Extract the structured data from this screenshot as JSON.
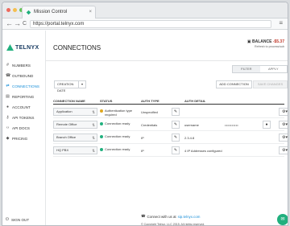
{
  "browser": {
    "tab_title": "Mission Control",
    "url": "https://portal.telnyx.com",
    "back_glyph": "←",
    "forward_glyph": "→",
    "reload_glyph": "C",
    "menu_glyph": "≡"
  },
  "brand": {
    "name": "TELNYX",
    "accent": "#1a8fd8"
  },
  "sidebar": {
    "items": [
      {
        "label": "NUMBERS",
        "icon": "hash-icon",
        "glyph": "#"
      },
      {
        "label": "OUTBOUND",
        "icon": "phone-icon",
        "glyph": "☎"
      },
      {
        "label": "CONNECTIONS",
        "icon": "connections-icon",
        "glyph": "⇄"
      },
      {
        "label": "REPORTING",
        "icon": "chart-icon",
        "glyph": "▤"
      },
      {
        "label": "ACCOUNT",
        "icon": "user-icon",
        "glyph": "●"
      },
      {
        "label": "API TOKENS",
        "icon": "key-icon",
        "glyph": "⚷"
      },
      {
        "label": "API DOCS",
        "icon": "code-icon",
        "glyph": "‹›"
      },
      {
        "label": "PRICING",
        "icon": "tag-icon",
        "glyph": "◆"
      }
    ],
    "sign_out": "SIGN OUT"
  },
  "header": {
    "title": "CONNECTIONS",
    "balance_label": "BALANCE",
    "balance_amount": "-$5.37",
    "balance_sub": "Refresh to process/sub"
  },
  "toolbar": {
    "filter_label": "FILTER",
    "apply_label": "APPLY",
    "sort_label": "CREATION DATE",
    "sort_glyph": "▾",
    "add_label": "ADD CONNECTION",
    "save_label": "SAVE CHANGES"
  },
  "table": {
    "headers": {
      "name": "CONNECTION NAME",
      "status": "STATUS",
      "auth_type": "AUTH TYPE",
      "auth_detail": "AUTH DETAIL"
    },
    "rows": [
      {
        "name": "Application",
        "status": "Authentication type required",
        "status_color": "#e0a81e",
        "auth_type": "Unspecified",
        "detail": "",
        "password": ""
      },
      {
        "name": "Remote Office",
        "status": "Connection ready",
        "status_color": "#21b07e",
        "auth_type": "Credentials",
        "detail": "username",
        "password": "••••••••••"
      },
      {
        "name": "Branch Office",
        "status": "Connection ready",
        "status_color": "#21b07e",
        "auth_type": "IP",
        "detail": "2.3.4.8",
        "password": ""
      },
      {
        "name": "HQ PBX",
        "status": "Connection ready",
        "status_color": "#21b07e",
        "auth_type": "IP",
        "detail": "4 IP Addresses configured",
        "password": ""
      }
    ]
  },
  "footer": {
    "connect_text": "Connect with us at",
    "connect_link": "sip.telnyx.com",
    "copyright": "© Copyright Telnyx, LLC 2015. All rights reserved."
  }
}
